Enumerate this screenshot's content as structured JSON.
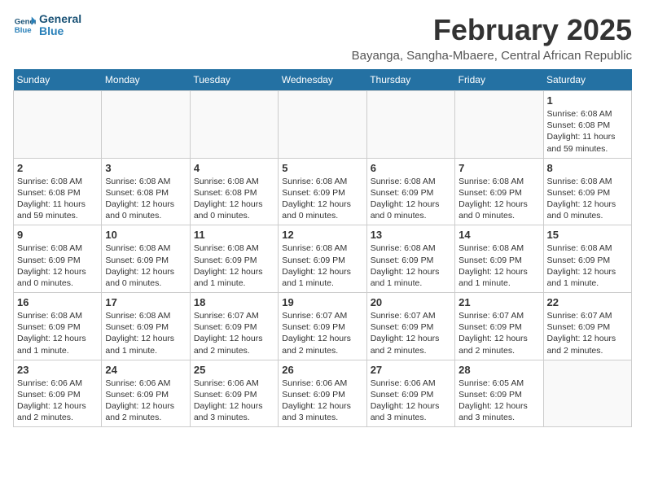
{
  "logo": {
    "line1": "General",
    "line2": "Blue"
  },
  "title": "February 2025",
  "location": "Bayanga, Sangha-Mbaere, Central African Republic",
  "days_of_week": [
    "Sunday",
    "Monday",
    "Tuesday",
    "Wednesday",
    "Thursday",
    "Friday",
    "Saturday"
  ],
  "weeks": [
    [
      {
        "day": "",
        "info": ""
      },
      {
        "day": "",
        "info": ""
      },
      {
        "day": "",
        "info": ""
      },
      {
        "day": "",
        "info": ""
      },
      {
        "day": "",
        "info": ""
      },
      {
        "day": "",
        "info": ""
      },
      {
        "day": "1",
        "info": "Sunrise: 6:08 AM\nSunset: 6:08 PM\nDaylight: 11 hours\nand 59 minutes."
      }
    ],
    [
      {
        "day": "2",
        "info": "Sunrise: 6:08 AM\nSunset: 6:08 PM\nDaylight: 11 hours\nand 59 minutes."
      },
      {
        "day": "3",
        "info": "Sunrise: 6:08 AM\nSunset: 6:08 PM\nDaylight: 12 hours\nand 0 minutes."
      },
      {
        "day": "4",
        "info": "Sunrise: 6:08 AM\nSunset: 6:08 PM\nDaylight: 12 hours\nand 0 minutes."
      },
      {
        "day": "5",
        "info": "Sunrise: 6:08 AM\nSunset: 6:09 PM\nDaylight: 12 hours\nand 0 minutes."
      },
      {
        "day": "6",
        "info": "Sunrise: 6:08 AM\nSunset: 6:09 PM\nDaylight: 12 hours\nand 0 minutes."
      },
      {
        "day": "7",
        "info": "Sunrise: 6:08 AM\nSunset: 6:09 PM\nDaylight: 12 hours\nand 0 minutes."
      },
      {
        "day": "8",
        "info": "Sunrise: 6:08 AM\nSunset: 6:09 PM\nDaylight: 12 hours\nand 0 minutes."
      }
    ],
    [
      {
        "day": "9",
        "info": "Sunrise: 6:08 AM\nSunset: 6:09 PM\nDaylight: 12 hours\nand 0 minutes."
      },
      {
        "day": "10",
        "info": "Sunrise: 6:08 AM\nSunset: 6:09 PM\nDaylight: 12 hours\nand 0 minutes."
      },
      {
        "day": "11",
        "info": "Sunrise: 6:08 AM\nSunset: 6:09 PM\nDaylight: 12 hours\nand 1 minute."
      },
      {
        "day": "12",
        "info": "Sunrise: 6:08 AM\nSunset: 6:09 PM\nDaylight: 12 hours\nand 1 minute."
      },
      {
        "day": "13",
        "info": "Sunrise: 6:08 AM\nSunset: 6:09 PM\nDaylight: 12 hours\nand 1 minute."
      },
      {
        "day": "14",
        "info": "Sunrise: 6:08 AM\nSunset: 6:09 PM\nDaylight: 12 hours\nand 1 minute."
      },
      {
        "day": "15",
        "info": "Sunrise: 6:08 AM\nSunset: 6:09 PM\nDaylight: 12 hours\nand 1 minute."
      }
    ],
    [
      {
        "day": "16",
        "info": "Sunrise: 6:08 AM\nSunset: 6:09 PM\nDaylight: 12 hours\nand 1 minute."
      },
      {
        "day": "17",
        "info": "Sunrise: 6:08 AM\nSunset: 6:09 PM\nDaylight: 12 hours\nand 1 minute."
      },
      {
        "day": "18",
        "info": "Sunrise: 6:07 AM\nSunset: 6:09 PM\nDaylight: 12 hours\nand 2 minutes."
      },
      {
        "day": "19",
        "info": "Sunrise: 6:07 AM\nSunset: 6:09 PM\nDaylight: 12 hours\nand 2 minutes."
      },
      {
        "day": "20",
        "info": "Sunrise: 6:07 AM\nSunset: 6:09 PM\nDaylight: 12 hours\nand 2 minutes."
      },
      {
        "day": "21",
        "info": "Sunrise: 6:07 AM\nSunset: 6:09 PM\nDaylight: 12 hours\nand 2 minutes."
      },
      {
        "day": "22",
        "info": "Sunrise: 6:07 AM\nSunset: 6:09 PM\nDaylight: 12 hours\nand 2 minutes."
      }
    ],
    [
      {
        "day": "23",
        "info": "Sunrise: 6:06 AM\nSunset: 6:09 PM\nDaylight: 12 hours\nand 2 minutes."
      },
      {
        "day": "24",
        "info": "Sunrise: 6:06 AM\nSunset: 6:09 PM\nDaylight: 12 hours\nand 2 minutes."
      },
      {
        "day": "25",
        "info": "Sunrise: 6:06 AM\nSunset: 6:09 PM\nDaylight: 12 hours\nand 3 minutes."
      },
      {
        "day": "26",
        "info": "Sunrise: 6:06 AM\nSunset: 6:09 PM\nDaylight: 12 hours\nand 3 minutes."
      },
      {
        "day": "27",
        "info": "Sunrise: 6:06 AM\nSunset: 6:09 PM\nDaylight: 12 hours\nand 3 minutes."
      },
      {
        "day": "28",
        "info": "Sunrise: 6:05 AM\nSunset: 6:09 PM\nDaylight: 12 hours\nand 3 minutes."
      },
      {
        "day": "",
        "info": ""
      }
    ]
  ]
}
